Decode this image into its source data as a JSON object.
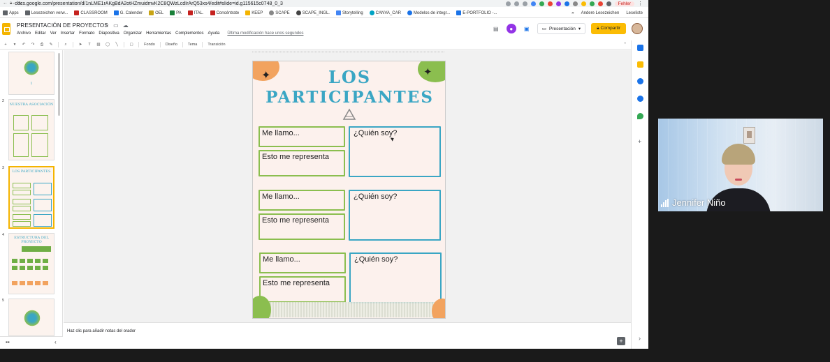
{
  "browser": {
    "url": "docs.google.com/presentation/d/1nLME1rAKgBdA2otHZmuidmvK2C8QWzLcdIrArQ53xs4/edit#slide=id.g115615c0748_0_3",
    "fehler": "Fehler"
  },
  "bookmarks": {
    "items": [
      {
        "label": "Apps",
        "color": "#5f6368"
      },
      {
        "label": "Lesezeichen verw...",
        "color": "#5f6368"
      },
      {
        "label": "CLASSROOM",
        "color": "#c5221f"
      },
      {
        "label": "G. Calender",
        "color": "#1a73e8"
      },
      {
        "label": "OEL",
        "color": "#c8a415"
      },
      {
        "label": "PA",
        "color": "#188038"
      },
      {
        "label": "ITAL.",
        "color": "#c5221f"
      },
      {
        "label": "Concéntrate",
        "color": "#c5221f"
      },
      {
        "label": "KEEP",
        "color": "#f4b400"
      },
      {
        "label": "SCAPE",
        "color": "#888888"
      },
      {
        "label": "SCAPE_INGL.",
        "color": "#444444"
      },
      {
        "label": "Storytelling",
        "color": "#4285f4"
      },
      {
        "label": "CANVA_CAR",
        "color": "#00a3c4"
      },
      {
        "label": "Modelos de integr...",
        "color": "#1a73e8"
      },
      {
        "label": "E-PORTFOLIO -...",
        "color": "#1a73e8"
      }
    ],
    "other": "Andere Lesezeichen",
    "reading": "Leseliste"
  },
  "document": {
    "title": "PRESENTACIÓN DE PROYECTOS",
    "menus": [
      "Archivo",
      "Editar",
      "Ver",
      "Insertar",
      "Formato",
      "Diapositiva",
      "Organizar",
      "Herramientas",
      "Complementos",
      "Ayuda"
    ],
    "last_edit": "Última modificación hace unos segundos",
    "present_label": "Presentación",
    "share_label": "Compartir"
  },
  "toolbar": {
    "fondo": "Fondo",
    "diseno": "Diseño",
    "tema": "Tema",
    "transicion": "Transición"
  },
  "filmstrip": {
    "slides": [
      {
        "num": "1",
        "title": ""
      },
      {
        "num": "2",
        "title": "NUESTRA ASOCIACIÓN"
      },
      {
        "num": "3",
        "title": "LOS PARTICIPANTES"
      },
      {
        "num": "4",
        "title": "ESTRUCTURA DEL PROYECTO"
      },
      {
        "num": "5",
        "title": ""
      }
    ],
    "slide1_number": "1"
  },
  "slide": {
    "title_line1": "LOS",
    "title_line2": "PARTICIPANTES",
    "rows": [
      {
        "name_label": "Me llamo...",
        "represent_label": "Esto me representa",
        "who_label": "¿Quién soy?"
      },
      {
        "name_label": "Me llamo...",
        "represent_label": "Esto me representa",
        "who_label": "¿Quién soy?"
      },
      {
        "name_label": "Me llamo...",
        "represent_label": "Esto me representa",
        "who_label": "¿Quién soy?"
      }
    ],
    "colors": {
      "green": "#8bbe4f",
      "blue": "#3aa6c4",
      "orange": "#f2a35f",
      "background": "#fcf1ed"
    }
  },
  "notes": {
    "placeholder": "Haz clic para añadir notas del orador"
  },
  "video": {
    "participant_name": "Jennifer Niño"
  }
}
